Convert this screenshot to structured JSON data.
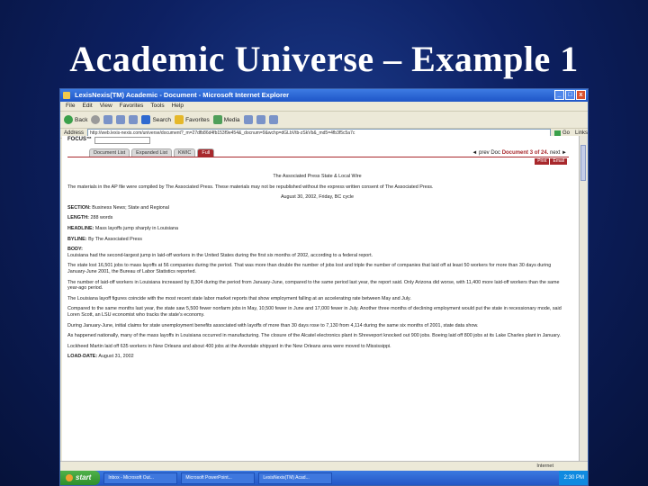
{
  "slide": {
    "title": "Academic Universe – Example 1"
  },
  "window": {
    "title": "LexisNexis(TM) Academic - Document - Microsoft Internet Explorer",
    "controls": [
      "_",
      "□",
      "x"
    ]
  },
  "menubar": [
    "File",
    "Edit",
    "View",
    "Favorites",
    "Tools",
    "Help"
  ],
  "toolbar": {
    "back_label": "Back",
    "search_label": "Search",
    "favorites_label": "Favorites",
    "media_label": "Media"
  },
  "address": {
    "label": "Address",
    "value": "http://web.lexis-nexis.com/universe/document?_m=27dfb86d4fb153f9e454&_docnum=9&wchp=dGLbVtb-zSkVb&_md5=4fb3f5c5a7c",
    "go_label": "Go",
    "links_label": "Links"
  },
  "focus": {
    "label": "FOCUS™"
  },
  "tabs": [
    "Document List",
    "Expanded List",
    "KWIC",
    "Full"
  ],
  "active_tab": 3,
  "docnav": {
    "prev": "◄ prev Doc",
    "current": "Document 3 of 24.",
    "next": "next ►"
  },
  "print_buttons": [
    "Print",
    "Email"
  ],
  "document": {
    "source": "The Associated Press State & Local Wire",
    "copyright": "The materials in the AP file were compiled by The Associated Press. These materials may not be republished without the express written consent of The Associated Press.",
    "date": "August 30, 2002, Friday, BC cycle",
    "section_label": "SECTION:",
    "section_value": "Business News; State and Regional",
    "length_label": "LENGTH:",
    "length_value": "288 words",
    "headline_label": "HEADLINE:",
    "headline_value": "Mass layoffs jump sharply in Louisiana",
    "byline_label": "BYLINE:",
    "byline_value": "By The Associated Press",
    "body_label": "BODY:",
    "paragraphs": [
      "Louisiana had the second-largest jump in laid-off workers in the United States during the first six months of 2002, according to a federal report.",
      "The state lost 16,501 jobs to mass layoffs at 56 companies during the period. That was more than double the number of jobs lost and triple the number of companies that laid off at least 50 workers for more than 30 days during January-June 2001, the Bureau of Labor Statistics reported.",
      "The number of laid-off workers in Louisiana increased by 8,304 during the period from January-June, compared to the same period last year, the report said. Only Arizona did worse, with 11,400 more laid-off workers than the same year-ago period.",
      "The Louisiana layoff figures coincide with the most recent state labor market reports that show employment falling at an accelerating rate between May and July.",
      "Compared to the same months last year, the state saw 5,500 fewer nonfarm jobs in May, 10,500 fewer in June and 17,000 fewer in July. Another three months of declining employment would put the state in recessionary mode, said Loren Scott, an LSU economist who tracks the state's economy.",
      "During January-June, initial claims for state unemployment benefits associated with layoffs of more than 30 days rose to 7,130 from 4,114 during the same six months of 2001, state data show.",
      "As happened nationally, many of the mass layoffs in Louisiana occurred in manufacturing. The closure of the Alcatel electronics plant in Shreveport knocked out 900 jobs. Boeing laid off 800 jobs at its Lake Charles plant in January.",
      "Lockheed Martin laid off 635 workers in New Orleans and about 400 jobs at the Avondale shipyard in the New Orleans area were moved to Mississippi."
    ],
    "loaddate_label": "LOAD-DATE:",
    "loaddate_value": "August 31, 2002"
  },
  "statusbar": {
    "left": "",
    "zone": "Internet"
  },
  "taskbar": {
    "start_label": "start",
    "tasks": [
      "Inbox - Microsoft Out...",
      "Microsoft PowerPoint...",
      "LexisNexis(TM) Acad..."
    ],
    "clock": "2:30 PM"
  }
}
